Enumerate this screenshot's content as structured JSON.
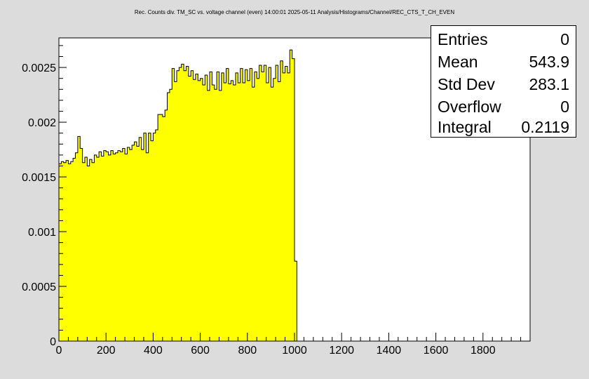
{
  "title": "Rec. Counts div. TM_SC vs. voltage channel (even)  14:00:01  2025-05-11  Analysis/Histograms/Channel/REC_CTS_T_CH_EVEN",
  "stats": [
    {
      "label": "Entries",
      "value": "0"
    },
    {
      "label": "Mean",
      "value": "543.9"
    },
    {
      "label": "Std Dev",
      "value": "283.1"
    },
    {
      "label": "Overflow",
      "value": "0"
    },
    {
      "label": "Integral",
      "value": "0.2119"
    }
  ],
  "colors": {
    "fill": "#ffff00",
    "line": "#000000",
    "frame_bg": "#ffffff",
    "canvas_bg": "#dcdcdc"
  },
  "chart_data": {
    "type": "histogram",
    "title": "Rec. Counts div. TM_SC vs. voltage channel (even)  14:00:01  2025-05-11  Analysis/Histograms/Channel/REC_CTS_T_CH_EVEN",
    "xlabel": "",
    "ylabel": "",
    "xlim": [
      0,
      2000
    ],
    "ylim": [
      0,
      0.00277
    ],
    "x_ticks": [
      0,
      200,
      400,
      600,
      800,
      1000,
      1200,
      1400,
      1600,
      1800
    ],
    "y_ticks": [
      0,
      0.0005,
      0.001,
      0.0015,
      0.002,
      0.0025
    ],
    "x_tick_labels": [
      "0",
      "200",
      "400",
      "600",
      "800",
      "1000",
      "1200",
      "1400",
      "1600",
      "1800"
    ],
    "y_tick_labels": [
      "0",
      "0.0005",
      "0.001",
      "0.0015",
      "0.002",
      "0.0025"
    ],
    "bin_width": 10,
    "bin_start": 0,
    "values": [
      0.00162,
      0.00164,
      0.00163,
      0.00165,
      0.00162,
      0.00164,
      0.00167,
      0.00172,
      0.00187,
      0.00176,
      0.00163,
      0.00168,
      0.0016,
      0.00166,
      0.00163,
      0.0017,
      0.00168,
      0.00173,
      0.00169,
      0.00174,
      0.00173,
      0.0017,
      0.00174,
      0.00171,
      0.00172,
      0.00174,
      0.00173,
      0.00176,
      0.00171,
      0.00177,
      0.00175,
      0.00179,
      0.00182,
      0.00178,
      0.00186,
      0.00175,
      0.0019,
      0.00172,
      0.0019,
      0.00183,
      0.0019,
      0.00193,
      0.00207,
      0.00207,
      0.00205,
      0.00211,
      0.00227,
      0.0023,
      0.00249,
      0.00237,
      0.00247,
      0.0025,
      0.00253,
      0.00247,
      0.00251,
      0.00242,
      0.00247,
      0.00239,
      0.00244,
      0.00238,
      0.0024,
      0.00234,
      0.00243,
      0.00229,
      0.00246,
      0.00234,
      0.0023,
      0.00246,
      0.00229,
      0.00245,
      0.00236,
      0.00249,
      0.00235,
      0.00238,
      0.00234,
      0.00245,
      0.00236,
      0.00249,
      0.00236,
      0.00248,
      0.00238,
      0.00249,
      0.00232,
      0.00246,
      0.0024,
      0.00252,
      0.00246,
      0.00252,
      0.00236,
      0.0025,
      0.00232,
      0.0024,
      0.00252,
      0.00237,
      0.00256,
      0.00245,
      0.00251,
      0.00245,
      0.00266,
      0.00258,
      0.00073
    ]
  }
}
